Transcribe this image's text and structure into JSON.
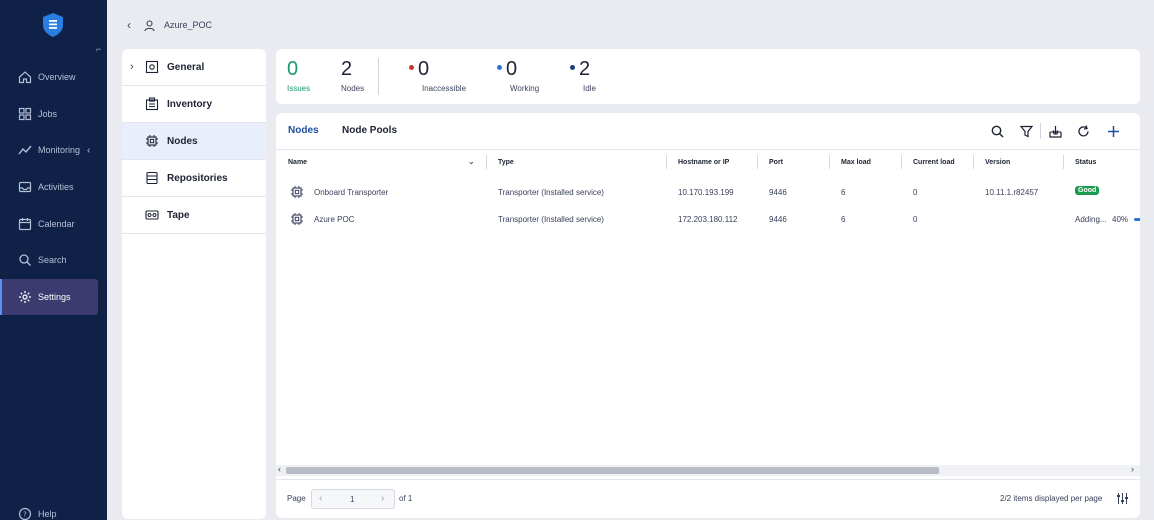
{
  "nav": {
    "items": [
      {
        "label": "Overview"
      },
      {
        "label": "Jobs"
      },
      {
        "label": "Monitoring"
      },
      {
        "label": "Activities"
      },
      {
        "label": "Calendar"
      },
      {
        "label": "Search"
      },
      {
        "label": "Settings"
      }
    ],
    "help": "Help",
    "active": "Settings"
  },
  "breadcrumb": {
    "title": "Azure_POC"
  },
  "settings_menu": {
    "items": [
      {
        "label": "General",
        "icon": "general-settings-icon"
      },
      {
        "label": "Inventory",
        "icon": "inventory-icon"
      },
      {
        "label": "Nodes",
        "icon": "chip-icon"
      },
      {
        "label": "Repositories",
        "icon": "repository-icon"
      },
      {
        "label": "Tape",
        "icon": "tape-icon"
      }
    ],
    "active": "Nodes"
  },
  "stats": {
    "issues": {
      "value": "0",
      "label": "Issues"
    },
    "nodes": {
      "value": "2",
      "label": "Nodes"
    },
    "inaccessible": {
      "value": "0",
      "label": "Inaccessible",
      "color": "#c0392b"
    },
    "working": {
      "value": "0",
      "label": "Working",
      "color": "#2f72d8"
    },
    "idle": {
      "value": "2",
      "label": "Idle",
      "color": "#1c3d7a"
    }
  },
  "tabs": [
    {
      "label": "Nodes"
    },
    {
      "label": "Node Pools"
    }
  ],
  "table": {
    "columns": [
      "Name",
      "Type",
      "Hostname or IP",
      "Port",
      "Max load",
      "Current load",
      "Version",
      "Status"
    ],
    "rows": [
      {
        "name": "Onboard Transporter",
        "type": "Transporter (Installed service)",
        "host": "10.170.193.199",
        "port": "9446",
        "max_load": "6",
        "current_load": "0",
        "version": "10.11.1.r82457",
        "status": "Good"
      },
      {
        "name": "Azure POC",
        "type": "Transporter (Installed service)",
        "host": "172.203.180.112",
        "port": "9446",
        "max_load": "6",
        "current_load": "0",
        "version": "",
        "status": "Adding...",
        "progress": "40%"
      }
    ]
  },
  "footer": {
    "page_label": "Page",
    "page_value": "1",
    "of_label": "of 1",
    "summary": "2/2 items displayed per page"
  },
  "colors": {
    "sidebar": "#0f2147",
    "accent": "#1c4f9c",
    "good": "#1e9a4f",
    "issues": "#1a9a6a"
  }
}
